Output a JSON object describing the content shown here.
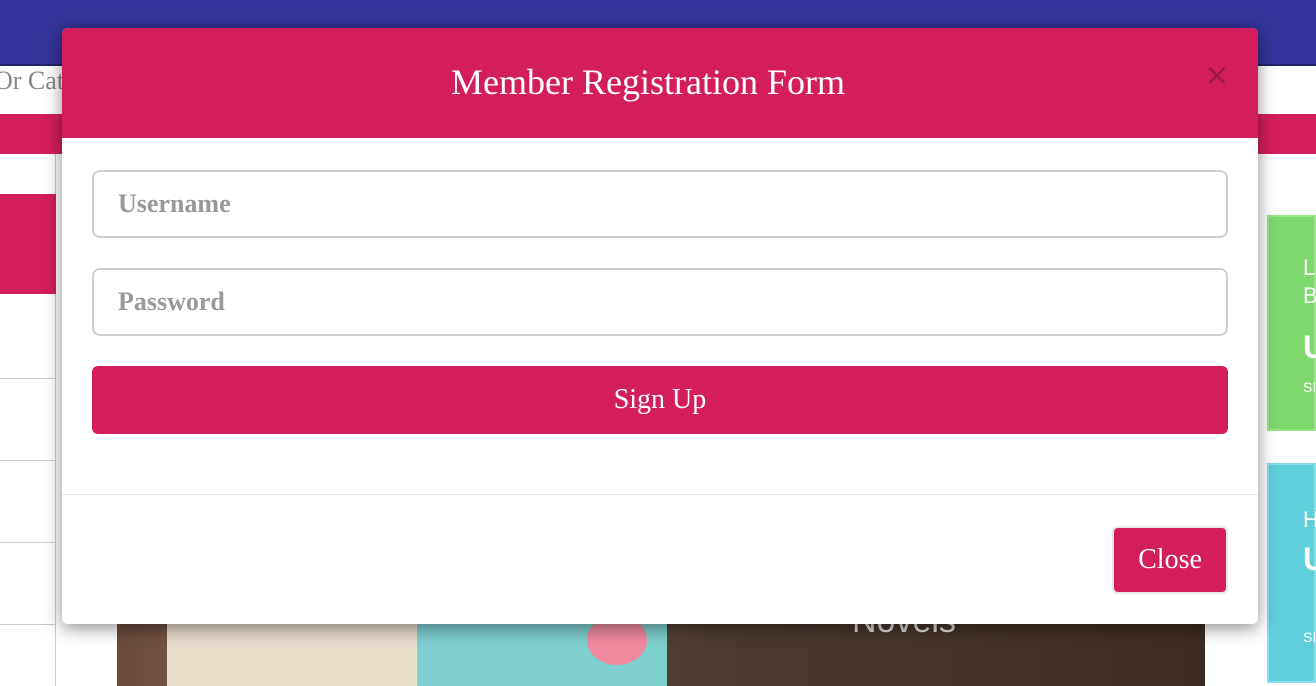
{
  "background": {
    "search_text": "Or Cat",
    "banner_text": "Novels",
    "green_card": {
      "line1": "L",
      "line2": "B",
      "big": "U",
      "small": "SI"
    },
    "blue_card": {
      "line1": "H",
      "big": "U",
      "small": "SI"
    }
  },
  "modal": {
    "title": "Member Registration Form",
    "close_icon": "×",
    "username_placeholder": "Username",
    "password_placeholder": "Password",
    "signup_label": "Sign Up",
    "close_label": "Close"
  },
  "colors": {
    "brand_pink": "#d41e5c",
    "top_bar": "#333399",
    "green_card": "#7fd86e",
    "blue_card": "#5fcfdc"
  }
}
